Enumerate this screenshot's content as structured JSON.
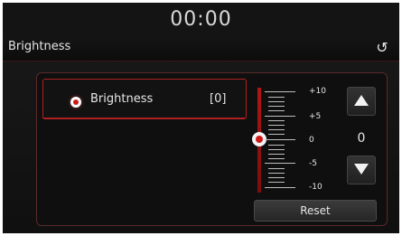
{
  "status": {
    "time": "00:00"
  },
  "header": {
    "title": "Brightness",
    "back_icon": "return-arrow-icon"
  },
  "setting": {
    "label": "Brightness",
    "value_bracket": "[0]"
  },
  "slider": {
    "value": 0,
    "min": -10,
    "max": 10,
    "tick_labels": [
      "+10",
      "+5",
      "0",
      "-5",
      "-10"
    ]
  },
  "controls": {
    "current_value": "0",
    "reset_label": "Reset",
    "up_icon": "triangle-up-icon",
    "down_icon": "triangle-down-icon"
  },
  "colors": {
    "accent": "#d01818",
    "background": "#121212"
  }
}
